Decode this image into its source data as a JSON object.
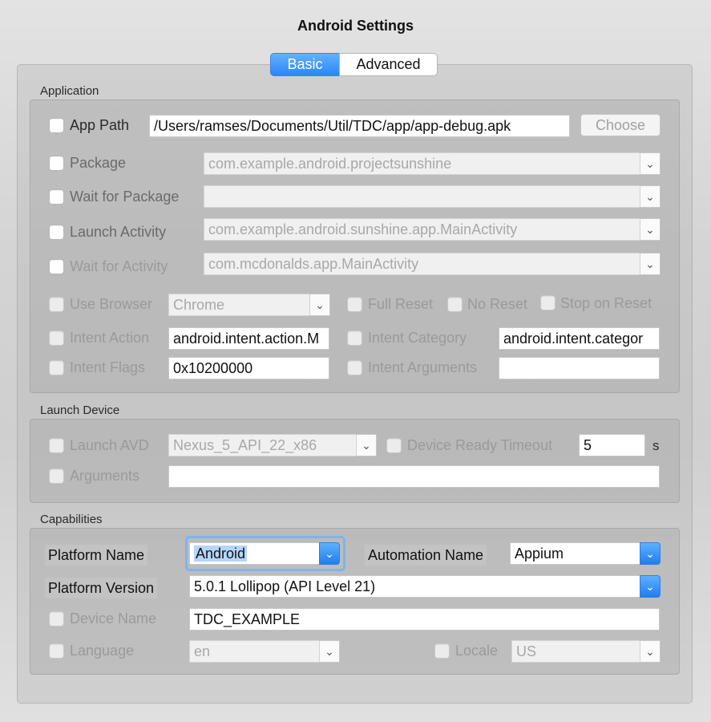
{
  "window": {
    "title": "Android Settings"
  },
  "tabs": {
    "basic": "Basic",
    "advanced": "Advanced",
    "selected": "Basic"
  },
  "application": {
    "group_label": "Application",
    "app_path": {
      "label": "App Path",
      "value": "/Users/ramses/Documents/Util/TDC/app/app-debug.apk",
      "choose_label": "Choose"
    },
    "package": {
      "label": "Package",
      "value": "com.example.android.projectsunshine"
    },
    "wait_for_package": {
      "label": "Wait for Package",
      "value": ""
    },
    "launch_activity": {
      "label": "Launch Activity",
      "value": "com.example.android.sunshine.app.MainActivity"
    },
    "wait_for_activity": {
      "label": "Wait for Activity",
      "value": "com.mcdonalds.app.MainActivity"
    },
    "use_browser": {
      "label": "Use Browser",
      "value": "Chrome"
    },
    "full_reset": {
      "label": "Full Reset"
    },
    "no_reset": {
      "label": "No Reset"
    },
    "stop_on_reset": {
      "label": "Stop on Reset"
    },
    "intent_action": {
      "label": "Intent Action",
      "value": "android.intent.action.M"
    },
    "intent_category": {
      "label": "Intent Category",
      "value": "android.intent.categor"
    },
    "intent_flags": {
      "label": "Intent Flags",
      "value": "0x10200000"
    },
    "intent_arguments": {
      "label": "Intent Arguments",
      "value": ""
    }
  },
  "launch_device": {
    "group_label": "Launch Device",
    "launch_avd": {
      "label": "Launch AVD",
      "value": "Nexus_5_API_22_x86"
    },
    "device_ready_timeout": {
      "label": "Device Ready Timeout",
      "value": "5",
      "unit": "s"
    },
    "arguments": {
      "label": "Arguments",
      "value": ""
    }
  },
  "capabilities": {
    "group_label": "Capabilities",
    "platform_name": {
      "label": "Platform Name",
      "value": "Android"
    },
    "automation_name": {
      "label": "Automation Name",
      "value": "Appium"
    },
    "platform_version": {
      "label": "Platform Version",
      "value": "5.0.1 Lollipop (API Level 21)"
    },
    "device_name": {
      "label": "Device Name",
      "value": "TDC_EXAMPLE"
    },
    "language": {
      "label": "Language",
      "value": "en"
    },
    "locale": {
      "label": "Locale",
      "value": "US"
    }
  },
  "icons": {
    "dropdown": "chevron-down-icon"
  },
  "colors": {
    "accent": "#2a86f5",
    "focus": "#7fb4ec"
  }
}
